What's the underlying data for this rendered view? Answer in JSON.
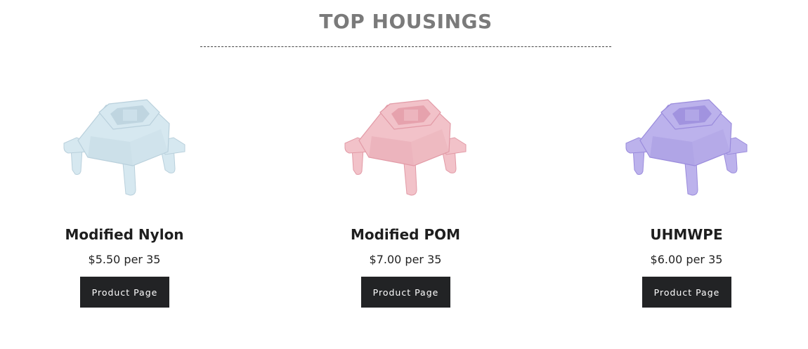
{
  "section": {
    "title": "TOP HOUSINGS"
  },
  "products": [
    {
      "name": "Modified Nylon",
      "price": "$5.50 per 35",
      "button_label": "Product Page",
      "color": "#d6e8f0",
      "shade": "#b9d0dc",
      "image": "keyboard-switch-housing-light-blue"
    },
    {
      "name": "Modified POM",
      "price": "$7.00 per 35",
      "button_label": "Product Page",
      "color": "#f2c2c9",
      "shade": "#e29aa6",
      "image": "keyboard-switch-housing-pink"
    },
    {
      "name": "UHMWPE",
      "price": "$6.00 per 35",
      "button_label": "Product Page",
      "color": "#bcb2ec",
      "shade": "#9a8bdc",
      "image": "keyboard-switch-housing-lavender"
    }
  ],
  "colors": {
    "title": "#7a7a7a",
    "button_bg": "#222325",
    "button_text": "#ffffff"
  }
}
